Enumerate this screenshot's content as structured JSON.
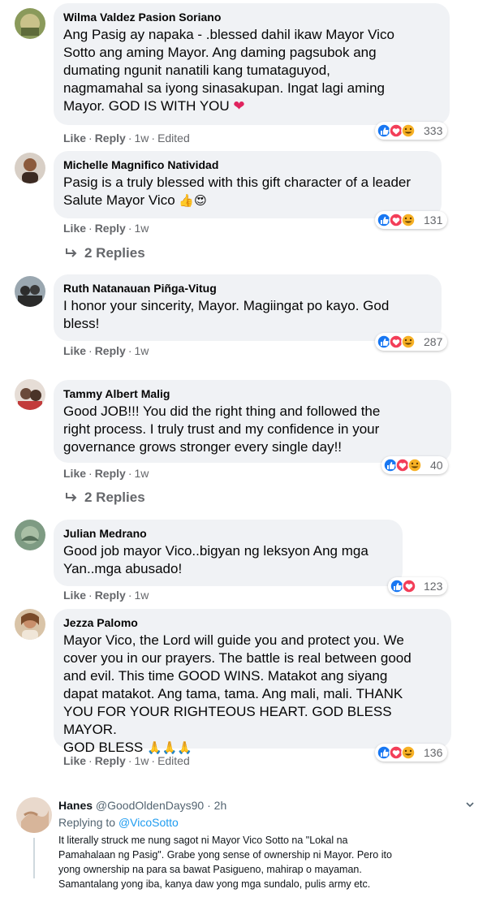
{
  "comments": [
    {
      "author": "Wilma Valdez Pasion Soriano",
      "text": "Ang Pasig ay napaka - .blessed dahil ikaw Mayor Vico\nSotto ang aming Mayor. Ang daming pagsubok ang\ndumating ngunit nanatili kang tumataguyod,\nnagmamahal sa iyong sinasakupan. Ingat lagi aming\nMayor. GOD IS WITH YOU",
      "like": "Like",
      "reply": "Reply",
      "time": "1w",
      "edited": "Edited",
      "reactions": "333",
      "emoji_suffix": "heart"
    },
    {
      "author": "Michelle Magnifico Natividad",
      "text": "Pasig is a truly blessed with this gift character of a leader\nSalute Mayor Vico",
      "like": "Like",
      "reply": "Reply",
      "time": "1w",
      "reactions": "131",
      "replies_label": "2 Replies"
    },
    {
      "author": "Ruth Natanauan Piñga-Vitug",
      "text": "I honor your sincerity, Mayor. Magiingat po kayo. God\nbless!",
      "like": "Like",
      "reply": "Reply",
      "time": "1w",
      "reactions": "287"
    },
    {
      "author": "Tammy Albert Malig",
      "text": "Good JOB!!! You did the right thing and followed the\nright process. I truly trust and my confidence in your\ngovernance grows stronger every single day!!",
      "like": "Like",
      "reply": "Reply",
      "time": "1w",
      "reactions": "40",
      "replies_label": "2 Replies"
    },
    {
      "author": "Julian Medrano",
      "text": "Good job mayor Vico..bigyan ng leksyon Ang mga\nYan..mga abusado!",
      "like": "Like",
      "reply": "Reply",
      "time": "1w",
      "reactions": "123"
    },
    {
      "author": "Jezza Palomo",
      "text": "Mayor Vico, the Lord will guide you and protect you. We\ncover you in our prayers. The battle is real between good\nand evil. This time GOOD WINS. Matakot ang siyang\ndapat matakot. Ang tama, tama. Ang mali, mali. THANK\nYOU FOR YOUR RIGHTEOUS HEART. GOD BLESS MAYOR.\nGOD BLESS",
      "like": "Like",
      "reply": "Reply",
      "time": "1w",
      "edited": "Edited",
      "reactions": "136"
    }
  ],
  "tweet": {
    "name": "Hanes",
    "handle": "@GoodOldenDays90",
    "time": "2h",
    "replying_prefix": "Replying to",
    "replying_handle": "@VicoSotto",
    "text": "It literally struck me nung sagot ni Mayor Vico Sotto na \"Lokal na\nPamahalaan ng Pasig\". Grabe yong sense of ownership ni Mayor. Pero ito\nyong ownership na para sa bawat Pasigueno, mahirap o mayaman.\nSamantalang yong iba, kanya daw yong mga sundalo, pulis army etc."
  },
  "colors": {
    "bubble": "#f0f2f5",
    "meta": "#65676b",
    "like_blue": "#1877f2",
    "love_red": "#f33e58",
    "haha_yellow": "#f7b125",
    "twitter_blue": "#1d9bf0"
  }
}
